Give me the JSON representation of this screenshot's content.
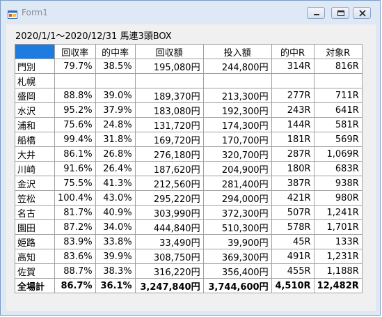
{
  "window": {
    "title": "Form1"
  },
  "heading": "2020/1/1～2020/12/31 馬連3頭BOX",
  "table": {
    "columns": [
      "",
      "回収率",
      "的中率",
      "回収額",
      "投入額",
      "的中R",
      "対象R"
    ],
    "rows": [
      [
        "門別",
        "79.7%",
        "38.5%",
        "195,080円",
        "244,800円",
        "314R",
        "816R"
      ],
      [
        "札幌",
        "",
        "",
        "",
        "",
        "",
        ""
      ],
      [
        "盛岡",
        "88.8%",
        "39.0%",
        "189,370円",
        "213,300円",
        "277R",
        "711R"
      ],
      [
        "水沢",
        "95.2%",
        "37.9%",
        "183,080円",
        "192,300円",
        "243R",
        "641R"
      ],
      [
        "浦和",
        "75.6%",
        "24.8%",
        "131,720円",
        "174,300円",
        "144R",
        "581R"
      ],
      [
        "船橋",
        "99.4%",
        "31.8%",
        "169,720円",
        "170,700円",
        "181R",
        "569R"
      ],
      [
        "大井",
        "86.1%",
        "26.8%",
        "276,180円",
        "320,700円",
        "287R",
        "1,069R"
      ],
      [
        "川崎",
        "91.6%",
        "26.4%",
        "187,620円",
        "204,900円",
        "180R",
        "683R"
      ],
      [
        "金沢",
        "75.5%",
        "41.3%",
        "212,560円",
        "281,400円",
        "387R",
        "938R"
      ],
      [
        "笠松",
        "100.4%",
        "43.0%",
        "295,220円",
        "294,000円",
        "421R",
        "980R"
      ],
      [
        "名古",
        "81.7%",
        "40.9%",
        "303,990円",
        "372,300円",
        "507R",
        "1,241R"
      ],
      [
        "園田",
        "87.2%",
        "34.0%",
        "444,840円",
        "510,300円",
        "578R",
        "1,701R"
      ],
      [
        "姫路",
        "83.9%",
        "33.8%",
        "33,490円",
        "39,900円",
        "45R",
        "133R"
      ],
      [
        "高知",
        "83.6%",
        "39.9%",
        "308,750円",
        "369,300円",
        "491R",
        "1,231R"
      ],
      [
        "佐賀",
        "88.7%",
        "38.3%",
        "316,220円",
        "356,400円",
        "455R",
        "1,188R"
      ]
    ],
    "total": [
      "全場計",
      "86.7%",
      "36.1%",
      "3,247,840円",
      "3,744,600円",
      "4,510R",
      "12,482R"
    ],
    "corner_color": "#1e7be0"
  },
  "icons": {
    "app": "app-form-icon",
    "minimize": "minimize-icon",
    "maximize": "maximize-icon",
    "close": "close-icon"
  }
}
